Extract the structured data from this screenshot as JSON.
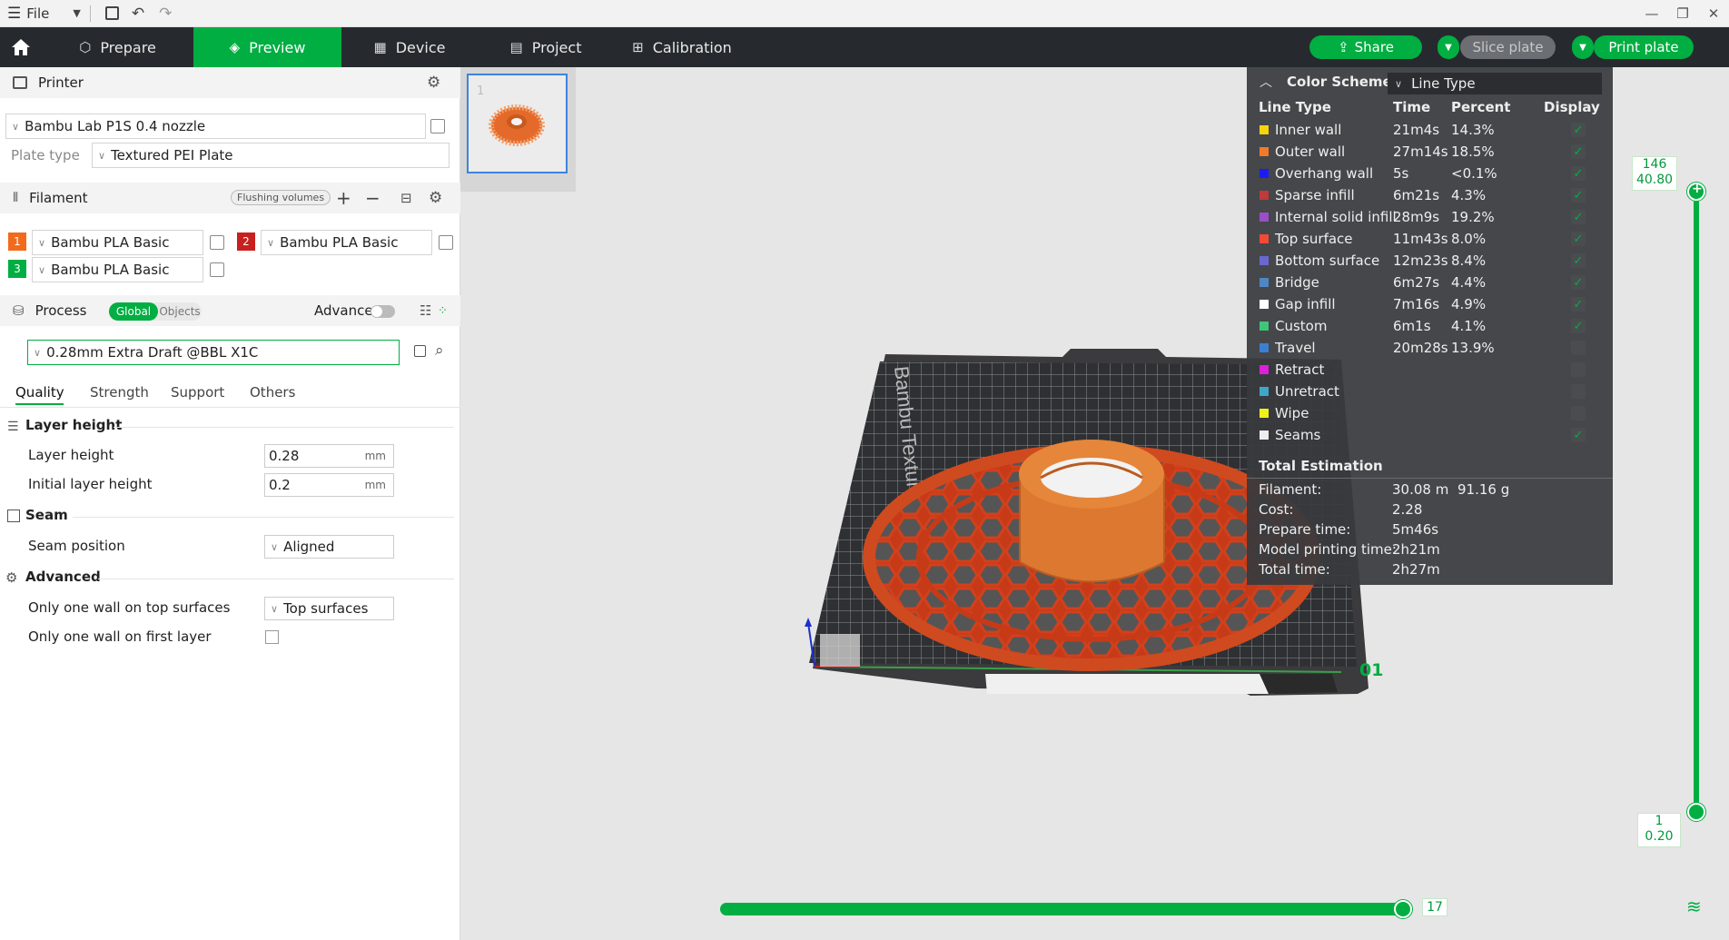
{
  "titlebar": {
    "file_label": "File"
  },
  "toolbar": {
    "tabs": [
      {
        "label": "Prepare",
        "icon": "cube-icon"
      },
      {
        "label": "Preview",
        "icon": "layers-icon"
      },
      {
        "label": "Device",
        "icon": "device-icon"
      },
      {
        "label": "Project",
        "icon": "project-icon"
      },
      {
        "label": "Calibration",
        "icon": "calibration-icon"
      }
    ],
    "share_label": "Share",
    "slice_label": "Slice plate",
    "print_label": "Print plate"
  },
  "printer": {
    "title": "Printer",
    "model": "Bambu Lab P1S 0.4 nozzle",
    "plate_type_label": "Plate type",
    "plate_type_value": "Textured PEI Plate"
  },
  "filament": {
    "title": "Filament",
    "flushing_label": "Flushing volumes",
    "slots": [
      {
        "num": "1",
        "color": "#f26b1d",
        "name": "Bambu PLA Basic"
      },
      {
        "num": "2",
        "color": "#c8201e",
        "name": "Bambu PLA Basic"
      },
      {
        "num": "3",
        "color": "#00ae42",
        "name": "Bambu PLA Basic"
      }
    ]
  },
  "process": {
    "title": "Process",
    "global_label": "Global",
    "objects_label": "Objects",
    "advance_label": "Advance",
    "profile": "0.28mm Extra Draft @BBL X1C",
    "subtabs": [
      "Quality",
      "Strength",
      "Support",
      "Others"
    ]
  },
  "settings": {
    "layer_height_group": "Layer height",
    "layer_height_label": "Layer height",
    "layer_height_value": "0.28",
    "initial_layer_label": "Initial layer height",
    "initial_layer_value": "0.2",
    "unit": "mm",
    "seam_group": "Seam",
    "seam_position_label": "Seam position",
    "seam_position_value": "Aligned",
    "advanced_group": "Advanced",
    "one_wall_top_label": "Only one wall on top surfaces",
    "one_wall_top_value": "Top surfaces",
    "one_wall_first_label": "Only one wall on first layer"
  },
  "plate_thumb": {
    "number": "1"
  },
  "bed": {
    "brand_text": "Bambu Textured PEI Plate",
    "plate_number": "01"
  },
  "legend": {
    "title": "Color Scheme",
    "scheme_value": "Line Type",
    "headers": {
      "type": "Line Type",
      "time": "Time",
      "percent": "Percent",
      "display": "Display"
    },
    "rows": [
      {
        "name": "Inner wall",
        "color": "#f5d40f",
        "time": "21m4s",
        "percent": "14.3%",
        "checked": true
      },
      {
        "name": "Outer wall",
        "color": "#ef7a2a",
        "time": "27m14s",
        "percent": "18.5%",
        "checked": true
      },
      {
        "name": "Overhang wall",
        "color": "#1c1cf2",
        "time": "5s",
        "percent": "<0.1%",
        "checked": true
      },
      {
        "name": "Sparse infill",
        "color": "#bf3a3a",
        "time": "6m21s",
        "percent": "4.3%",
        "checked": true
      },
      {
        "name": "Internal solid infill",
        "color": "#9a4fc7",
        "time": "28m9s",
        "percent": "19.2%",
        "checked": true
      },
      {
        "name": "Top surface",
        "color": "#f24a38",
        "time": "11m43s",
        "percent": "8.0%",
        "checked": true
      },
      {
        "name": "Bottom surface",
        "color": "#6a68cf",
        "time": "12m23s",
        "percent": "8.4%",
        "checked": true
      },
      {
        "name": "Bridge",
        "color": "#4f86c4",
        "time": "6m27s",
        "percent": "4.4%",
        "checked": true
      },
      {
        "name": "Gap infill",
        "color": "#ffffff",
        "time": "7m16s",
        "percent": "4.9%",
        "checked": true
      },
      {
        "name": "Custom",
        "color": "#3fc47a",
        "time": "6m1s",
        "percent": "4.1%",
        "checked": true
      },
      {
        "name": "Travel",
        "color": "#3a7fd4",
        "time": "20m28s",
        "percent": "13.9%",
        "checked": false
      },
      {
        "name": "Retract",
        "color": "#e01fd8",
        "time": "",
        "percent": "",
        "checked": false
      },
      {
        "name": "Unretract",
        "color": "#3fa6c9",
        "time": "",
        "percent": "",
        "checked": false
      },
      {
        "name": "Wipe",
        "color": "#f0f01a",
        "time": "",
        "percent": "",
        "checked": false
      },
      {
        "name": "Seams",
        "color": "#eeeeee",
        "time": "",
        "percent": "",
        "checked": true
      }
    ],
    "total_title": "Total Estimation",
    "filament_label": "Filament:",
    "filament_length": "30.08 m",
    "filament_weight": "91.16 g",
    "cost_label": "Cost:",
    "cost_value": "2.28",
    "prepare_label": "Prepare time:",
    "prepare_value": "5m46s",
    "model_time_label": "Model printing time:",
    "model_time_value": "2h21m",
    "total_time_label": "Total time:",
    "total_time_value": "2h27m"
  },
  "layer_slider": {
    "top_layer": "146",
    "top_height": "40.80",
    "bottom_layer": "1",
    "bottom_height": "0.20"
  },
  "move_slider": {
    "value": "17"
  }
}
